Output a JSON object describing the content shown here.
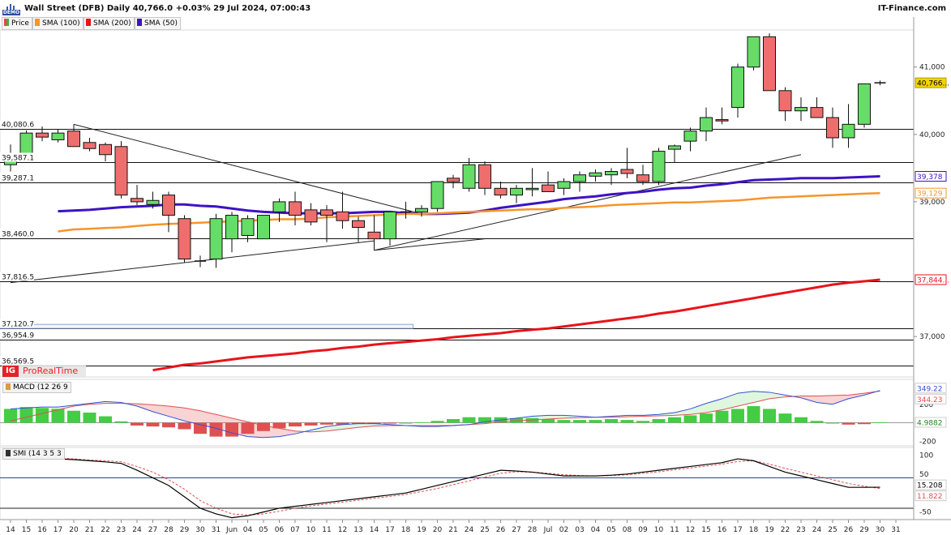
{
  "header": {
    "title": "Wall Street (DFB) Daily 40,766.0 +0.03% 29 Jul 2024, 07:00:43",
    "brand": "IT-Finance.com",
    "demo_badge": "DEMO"
  },
  "legend": [
    {
      "label": "Price",
      "color": "#3cb043"
    },
    {
      "label": "SMA (100)",
      "color": "#f6952a"
    },
    {
      "label": "SMA (200)",
      "color": "#e8141b"
    },
    {
      "label": "SMA (50)",
      "color": "#3d13c4"
    }
  ],
  "watermark": {
    "logo_text": "IG",
    "label": "ProRealTime"
  },
  "colors": {
    "up": "#66dd66",
    "down": "#ee6e6e",
    "sma50": "#3d13c4",
    "sma100": "#f6952a",
    "sma200": "#e8141b",
    "macd": "#3650d6",
    "signal": "#e05050",
    "smi": "#000000",
    "smi_signal": "#e05050",
    "zone": "#8aa6d8"
  },
  "chart_data": [
    {
      "type": "candlestick",
      "title": "Wall Street (DFB) Daily",
      "ylim": [
        36400,
        41550
      ],
      "y_ticks": [
        "41,000",
        "40,000",
        "39,000",
        "37,000"
      ],
      "x": [
        "14",
        "15",
        "16",
        "17",
        "20",
        "21",
        "22",
        "23",
        "24",
        "27",
        "28",
        "29",
        "30",
        "31",
        "Jun",
        "04",
        "05",
        "06",
        "07",
        "10",
        "11",
        "12",
        "13",
        "14",
        "17",
        "18",
        "19",
        "20",
        "21",
        "24",
        "25",
        "26",
        "27",
        "28",
        "Jul",
        "02",
        "03",
        "05",
        "08",
        "09",
        "10",
        "11",
        "12",
        "15",
        "16",
        "17",
        "18",
        "19",
        "22",
        "23",
        "24",
        "25",
        "26",
        "29"
      ],
      "x_labels": [
        "14",
        "15",
        "16",
        "17",
        "20",
        "21",
        "22",
        "23",
        "24",
        "27",
        "28",
        "29",
        "30",
        "31",
        "Jun",
        "04",
        "05",
        "06",
        "07",
        "10",
        "11",
        "12",
        "13",
        "14",
        "17",
        "18",
        "19",
        "20",
        "21",
        "24",
        "25",
        "26",
        "27",
        "28",
        "Jul",
        "02",
        "03",
        "04",
        "05",
        "08",
        "09",
        "10",
        "11",
        "12",
        "15",
        "16",
        "17",
        "18",
        "19",
        "22",
        "23",
        "24",
        "25",
        "26",
        "29",
        "30",
        "31"
      ],
      "ohlc": [
        [
          39550,
          39850,
          39450,
          39700
        ],
        [
          39700,
          40060,
          39650,
          40020
        ],
        [
          40020,
          40120,
          39900,
          39960
        ],
        [
          39920,
          40080,
          39880,
          40020
        ],
        [
          40050,
          40150,
          39900,
          39820
        ],
        [
          39880,
          39950,
          39750,
          39790
        ],
        [
          39850,
          39880,
          39600,
          39700
        ],
        [
          39820,
          39900,
          39050,
          39100
        ],
        [
          39050,
          39250,
          38950,
          39000
        ],
        [
          38960,
          39150,
          38900,
          39020
        ],
        [
          39100,
          39150,
          38550,
          38800
        ],
        [
          38750,
          38800,
          38100,
          38150
        ],
        [
          38120,
          38200,
          38030,
          38120
        ],
        [
          38150,
          38820,
          38020,
          38750
        ],
        [
          38450,
          38850,
          38250,
          38800
        ],
        [
          38500,
          38800,
          38400,
          38750
        ],
        [
          38450,
          38800,
          38450,
          38800
        ],
        [
          38850,
          39050,
          38700,
          39000
        ],
        [
          39000,
          39150,
          38650,
          38800
        ],
        [
          38880,
          38980,
          38650,
          38700
        ],
        [
          38880,
          38950,
          38400,
          38800
        ],
        [
          38850,
          39150,
          38600,
          38720
        ],
        [
          38720,
          38780,
          38400,
          38620
        ],
        [
          38550,
          38800,
          38280,
          38450
        ],
        [
          38450,
          38800,
          38350,
          38850
        ],
        [
          38850,
          39000,
          38750,
          38850
        ],
        [
          38850,
          38950,
          38780,
          38900
        ],
        [
          38900,
          39300,
          38850,
          39300
        ],
        [
          39350,
          39400,
          39200,
          39300
        ],
        [
          39200,
          39650,
          39150,
          39550
        ],
        [
          39550,
          39600,
          39100,
          39200
        ],
        [
          39200,
          39300,
          39050,
          39100
        ],
        [
          39100,
          39250,
          38980,
          39200
        ],
        [
          39180,
          39500,
          39080,
          39200
        ],
        [
          39250,
          39450,
          39200,
          39150
        ],
        [
          39200,
          39350,
          39100,
          39300
        ],
        [
          39300,
          39450,
          39150,
          39400
        ],
        [
          39380,
          39480,
          39300,
          39430
        ],
        [
          39400,
          39500,
          39250,
          39450
        ],
        [
          39480,
          39800,
          39350,
          39420
        ],
        [
          39400,
          39550,
          39250,
          39300
        ],
        [
          39300,
          39800,
          39250,
          39750
        ],
        [
          39780,
          39850,
          39580,
          39830
        ],
        [
          39900,
          40100,
          39750,
          40050
        ],
        [
          40050,
          40400,
          39900,
          40250
        ],
        [
          40220,
          40400,
          40150,
          40200
        ],
        [
          40400,
          41050,
          40250,
          41000
        ],
        [
          41000,
          41400,
          40950,
          41450
        ],
        [
          41450,
          41500,
          40800,
          40650
        ],
        [
          40650,
          40700,
          40200,
          40350
        ],
        [
          40350,
          40550,
          40200,
          40400
        ],
        [
          40400,
          40550,
          40250,
          40250
        ],
        [
          40250,
          40400,
          39800,
          39950
        ],
        [
          39950,
          40450,
          39800,
          40150
        ],
        [
          40150,
          40750,
          40100,
          40750
        ],
        [
          40766,
          40800,
          40730,
          40766
        ]
      ],
      "series": [
        {
          "name": "SMA (50)",
          "values": [
            38860,
            38870,
            38880,
            38900,
            38920,
            38930,
            38940,
            38960,
            38960,
            38940,
            38930,
            38900,
            38870,
            38850,
            38840,
            38830,
            38830,
            38830,
            38830,
            38840,
            38850,
            38850,
            38830,
            38820,
            38820,
            38830,
            38840,
            38870,
            38910,
            38940,
            38970,
            39000,
            39040,
            39060,
            39080,
            39110,
            39130,
            39150,
            39180,
            39200,
            39210,
            39240,
            39260,
            39290,
            39320,
            39330,
            39340,
            39350,
            39350,
            39350,
            39360,
            39370,
            39378
          ]
        },
        {
          "name": "SMA (100)",
          "values": [
            38560,
            38590,
            38600,
            38610,
            38620,
            38640,
            38660,
            38670,
            38680,
            38690,
            38700,
            38710,
            38720,
            38730,
            38740,
            38740,
            38750,
            38770,
            38780,
            38790,
            38800,
            38810,
            38820,
            38820,
            38830,
            38840,
            38850,
            38860,
            38870,
            38880,
            38890,
            38890,
            38910,
            38920,
            38930,
            38950,
            38960,
            38970,
            38980,
            38990,
            38990,
            39000,
            39010,
            39020,
            39040,
            39060,
            39070,
            39080,
            39090,
            39100,
            39110,
            39120,
            39129
          ]
        },
        {
          "name": "SMA (200)",
          "values": [
            36500,
            36540,
            36580,
            36600,
            36630,
            36660,
            36690,
            36710,
            36730,
            36750,
            36780,
            36800,
            36830,
            36850,
            36880,
            36900,
            36920,
            36940,
            36960,
            36990,
            37010,
            37030,
            37050,
            37080,
            37100,
            37120,
            37150,
            37180,
            37210,
            37240,
            37270,
            37300,
            37340,
            37370,
            37410,
            37450,
            37490,
            37530,
            37570,
            37610,
            37650,
            37690,
            37730,
            37770,
            37800,
            37820,
            37844
          ]
        }
      ],
      "levels": [
        {
          "label": "40,080.6",
          "value": 40080.6
        },
        {
          "label": "39,587.1",
          "value": 39587.1
        },
        {
          "label": "39,287.1",
          "value": 39287.1
        },
        {
          "label": "38,460.0",
          "value": 38460.0
        },
        {
          "label": "37,816.5",
          "value": 37816.5
        },
        {
          "label": "37,120.7",
          "value": 37120.7
        },
        {
          "label": "36,954.9",
          "value": 36954.9
        },
        {
          "label": "36,569.5",
          "value": 36569.5
        }
      ],
      "zone": {
        "from": 37120.7,
        "to": 37180,
        "start_index": 0,
        "end_index": 25
      },
      "trendlines": [
        {
          "from": [
            4,
            40150
          ],
          "to": [
            26,
            38820
          ]
        },
        {
          "from": [
            0,
            37800
          ],
          "to": [
            23,
            38420
          ]
        },
        {
          "from": [
            23,
            38280
          ],
          "to": [
            30,
            38450
          ]
        },
        {
          "from": [
            23,
            38280
          ],
          "to": [
            50,
            39700
          ]
        }
      ],
      "value_badges": [
        {
          "label": "40,766...",
          "value": 40766,
          "series": "Price"
        },
        {
          "label": "39,378",
          "value": 39378,
          "series": "SMA (50)"
        },
        {
          "label": "39,129",
          "value": 39129,
          "series": "SMA (100)"
        },
        {
          "label": "37,844...",
          "value": 37844,
          "series": "SMA (200)"
        }
      ]
    },
    {
      "type": "bar",
      "title": "MACD (12 26 9",
      "ylim": [
        -250,
        470
      ],
      "y_ticks": [
        "200",
        "-200"
      ],
      "histogram": [
        150,
        170,
        160,
        150,
        130,
        110,
        70,
        15,
        -30,
        -40,
        -50,
        -70,
        -120,
        -150,
        -150,
        -120,
        -90,
        -60,
        -40,
        -30,
        -20,
        -20,
        -10,
        -10,
        -5,
        0,
        5,
        20,
        40,
        60,
        60,
        60,
        50,
        50,
        40,
        30,
        30,
        30,
        40,
        30,
        20,
        40,
        60,
        80,
        100,
        130,
        150,
        180,
        150,
        100,
        60,
        20,
        0,
        -20,
        -15,
        5
      ],
      "series": [
        {
          "name": "MACD",
          "values": [
            150,
            160,
            170,
            170,
            190,
            210,
            230,
            220,
            180,
            120,
            70,
            20,
            -20,
            -60,
            -110,
            -150,
            -160,
            -150,
            -120,
            -80,
            -40,
            -20,
            -10,
            -10,
            -20,
            -30,
            -40,
            -40,
            -30,
            -20,
            10,
            30,
            50,
            70,
            80,
            80,
            70,
            60,
            70,
            80,
            80,
            90,
            110,
            150,
            210,
            260,
            320,
            340,
            330,
            300,
            270,
            220,
            200,
            260,
            300,
            349.22
          ]
        },
        {
          "name": "Signal",
          "values": [
            20,
            60,
            100,
            140,
            180,
            200,
            210,
            210,
            205,
            195,
            180,
            160,
            130,
            90,
            50,
            10,
            -30,
            -60,
            -90,
            -100,
            -90,
            -70,
            -50,
            -35,
            -30,
            -30,
            -30,
            -30,
            -28,
            -20,
            -10,
            10,
            20,
            30,
            40,
            50,
            55,
            60,
            60,
            65,
            70,
            75,
            80,
            90,
            110,
            140,
            180,
            220,
            260,
            280,
            290,
            290,
            295,
            300,
            320,
            344.23
          ]
        }
      ],
      "value_badges": [
        "349.22",
        "344.23",
        "4.9882"
      ]
    },
    {
      "type": "line",
      "title": "SMI (14 3 5 3",
      "ylim": [
        -70,
        120
      ],
      "y_ticks": [
        "100",
        "50",
        "-50"
      ],
      "levels": [
        40,
        -40
      ],
      "series": [
        {
          "name": "SMI",
          "values": [
            95,
            92,
            90,
            88,
            85,
            82,
            78,
            60,
            40,
            20,
            -10,
            -40,
            -55,
            -65,
            -60,
            -50,
            -40,
            -35,
            -30,
            -25,
            -20,
            -15,
            -10,
            -5,
            0,
            10,
            20,
            30,
            40,
            50,
            60,
            58,
            55,
            50,
            45,
            45,
            45,
            47,
            50,
            55,
            60,
            65,
            70,
            75,
            80,
            90,
            85,
            70,
            55,
            45,
            35,
            25,
            15,
            15,
            15.208
          ]
        },
        {
          "name": "Signal",
          "values": [
            96,
            94,
            92,
            90,
            87,
            85,
            82,
            70,
            55,
            35,
            10,
            -20,
            -40,
            -55,
            -58,
            -55,
            -48,
            -40,
            -34,
            -29,
            -24,
            -19,
            -14,
            -9,
            -4,
            4,
            12,
            22,
            32,
            42,
            52,
            56,
            55,
            52,
            48,
            46,
            45,
            46,
            48,
            52,
            56,
            61,
            66,
            71,
            76,
            83,
            85,
            76,
            65,
            55,
            45,
            35,
            25,
            18,
            11.822
          ]
        }
      ],
      "value_badges": [
        "15.208",
        "11.822"
      ]
    }
  ]
}
